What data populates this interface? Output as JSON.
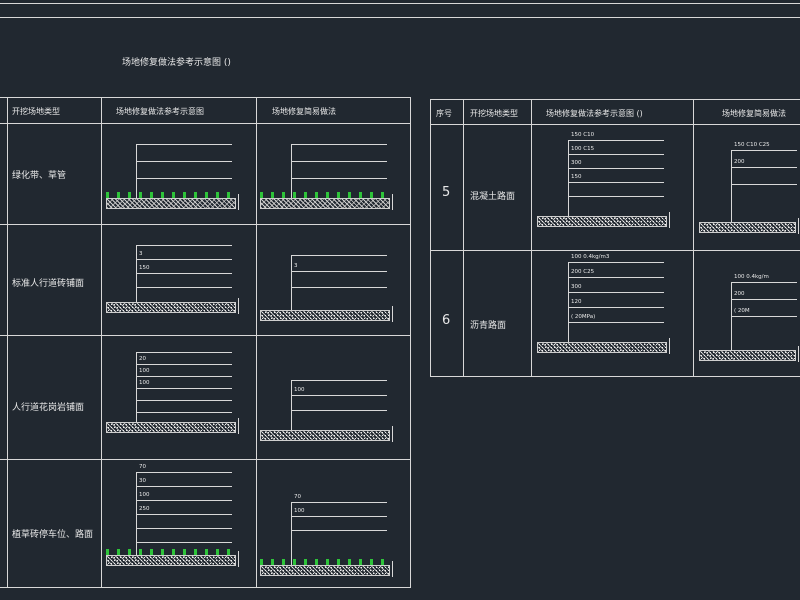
{
  "title": "场地修复做法参考示意图 ()",
  "left_table": {
    "headers": [
      "",
      "开挖场地类型",
      "场地修复做法参考示意图",
      "场地修复简易做法"
    ],
    "rows": [
      {
        "label": "绿化带、草管",
        "diagram_layers": [
          "",
          "",
          ""
        ],
        "simple_layers": [
          "",
          "",
          ""
        ]
      },
      {
        "label": "标准人行道砖铺面",
        "diagram_layers": [
          "",
          "3",
          "150",
          ""
        ],
        "simple_layers": [
          "",
          "3",
          ""
        ]
      },
      {
        "label": "人行道花岗岩铺面",
        "diagram_layers": [
          "",
          "20",
          "100",
          "100",
          "",
          ""
        ],
        "simple_layers": [
          "",
          "100",
          ""
        ]
      },
      {
        "label": "植草砖停车位、路面",
        "diagram_layers": [
          "70",
          "30",
          "100",
          "250",
          "",
          ""
        ],
        "simple_layers": [
          "70",
          "100",
          ""
        ]
      }
    ]
  },
  "right_table": {
    "headers": [
      "序号",
      "开挖场地类型",
      "场地修复做法参考示意图 ()",
      "场地修复简易做法"
    ],
    "rows": [
      {
        "number": "5",
        "label": "混凝土路面",
        "diagram_layers": [
          "150 C10",
          "100 C15",
          "300",
          "150",
          ""
        ],
        "simple_layers": [
          "150 C10 C25",
          "200",
          ""
        ]
      },
      {
        "number": "6",
        "label": "沥青路面",
        "diagram_layers": [
          "100 0.4kg/m3",
          "200 C25",
          "300",
          "120",
          "( 20MPa)"
        ],
        "simple_layers": [
          "100 0.4kg/m",
          "200",
          "( 20M"
        ]
      }
    ]
  },
  "colors": {
    "background": "#212830",
    "line": "#d8d8d8",
    "grass": "#2ec43a"
  }
}
